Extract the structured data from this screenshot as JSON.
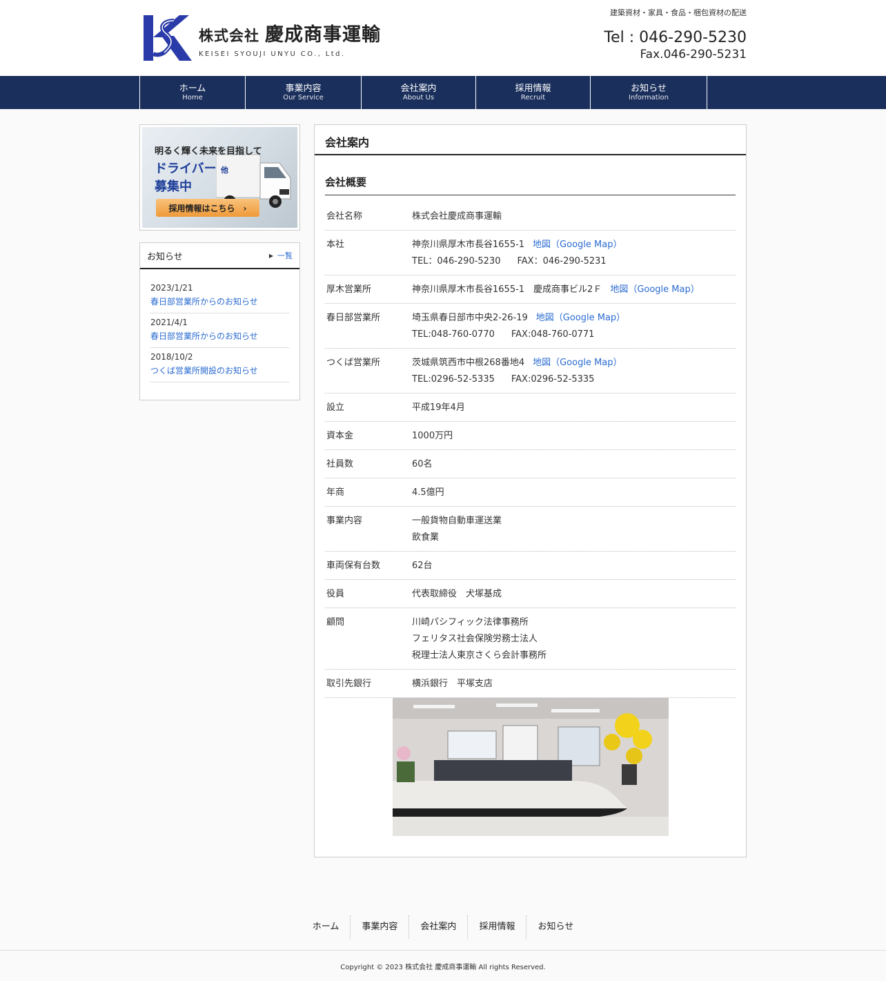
{
  "header": {
    "logo_kaisha": "株式会社",
    "logo_name": "慶成商事運輸",
    "logo_sub": "KEISEI SYOUJI UNYU CO., Ltd.",
    "tagline": "建築資材・家具・食品・梱包資材の配送",
    "tel": "Tel : 046-290-5230",
    "fax": "Fax.046-290-5231"
  },
  "nav": [
    {
      "jp": "ホーム",
      "en": "Home"
    },
    {
      "jp": "事業内容",
      "en": "Our Service"
    },
    {
      "jp": "会社案内",
      "en": "About Us"
    },
    {
      "jp": "採用情報",
      "en": "Recruit"
    },
    {
      "jp": "お知らせ",
      "en": "Information"
    }
  ],
  "banner": {
    "line1": "明るく輝く未来を目指して",
    "line2": "ドライバー",
    "line2_small": "他",
    "line3": "募集中",
    "button": "採用情報はこちら　›"
  },
  "news": {
    "title": "お知らせ",
    "more": "一覧",
    "items": [
      {
        "date": "2023/1/21",
        "title": "春日部営業所からのお知らせ"
      },
      {
        "date": "2021/4/1",
        "title": "春日部営業所からのお知らせ"
      },
      {
        "date": "2018/10/2",
        "title": "つくば営業所開設のお知らせ"
      }
    ]
  },
  "main": {
    "page_title": "会社案内",
    "section_title": "会社概要",
    "map_label": "地図（Google Map）",
    "rows": {
      "name": {
        "key": "会社名称",
        "val": "株式会社慶成商事運輸"
      },
      "hq": {
        "key": "本社",
        "addr": "神奈川県厚木市長谷1655-1",
        "tel": "TEL：046-290-5230",
        "fax": "FAX：046-290-5231"
      },
      "atsugi": {
        "key": "厚木営業所",
        "addr": "神奈川県厚木市長谷1655-1　慶成商事ビル2Ｆ"
      },
      "kasukabe": {
        "key": "春日部営業所",
        "addr": "埼玉県春日部市中央2-26-19",
        "tel": "TEL:048-760-0770",
        "fax": "FAX:048-760-0771"
      },
      "tsukuba": {
        "key": "つくば営業所",
        "addr": "茨城県筑西市中根268番地4",
        "tel": "TEL:0296-52-5335",
        "fax": "FAX:0296-52-5335"
      },
      "founded": {
        "key": "設立",
        "val": "平成19年4月"
      },
      "capital": {
        "key": "資本金",
        "val": "1000万円"
      },
      "employees": {
        "key": "社員数",
        "val": "60名"
      },
      "sales": {
        "key": "年商",
        "val": "4.5億円"
      },
      "business": {
        "key": "事業内容",
        "val1": "一般貨物自動車運送業",
        "val2": "飲食業"
      },
      "vehicles": {
        "key": "車両保有台数",
        "val": "62台"
      },
      "officers": {
        "key": "役員",
        "val": "代表取締役　犬塚基成"
      },
      "advisors": {
        "key": "顧問",
        "val1": "川崎パシフィック法律事務所",
        "val2": "フェリタス社会保険労務士法人",
        "val3": "税理士法人東京さくら会計事務所"
      },
      "bank": {
        "key": "取引先銀行",
        "val": "横浜銀行　平塚支店"
      }
    }
  },
  "footer": {
    "links": [
      "ホーム",
      "事業内容",
      "会社案内",
      "採用情報",
      "お知らせ"
    ],
    "copyright": "Copyright © 2023 株式会社 慶成商事運輸 All rights Reserved."
  },
  "colors": {
    "nav_bg": "#1a2f5c",
    "link": "#2a6bd1",
    "logo_blue": "#2a3aa8"
  }
}
